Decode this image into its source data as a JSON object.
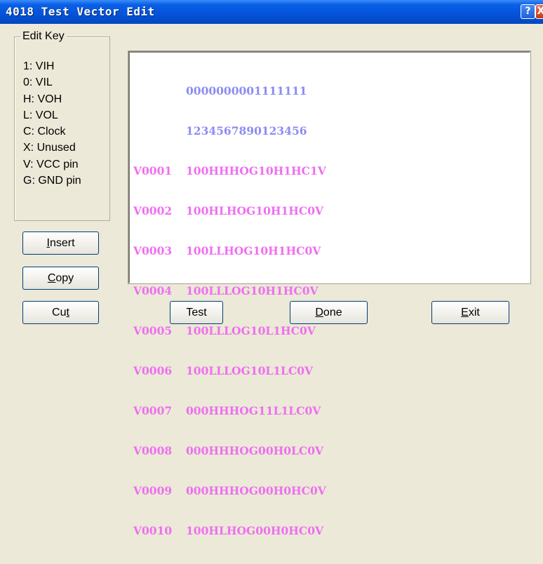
{
  "window": {
    "title": "4018 Test Vector Edit",
    "help_glyph": "?",
    "close_glyph": "X"
  },
  "edit_key": {
    "legend": "Edit Key",
    "items": [
      "1: VIH",
      "0: VIL",
      "H: VOH",
      "L: VOL",
      "C: Clock",
      "X: Unused",
      "V: VCC pin",
      "G: GND pin"
    ]
  },
  "editor": {
    "header_rows": [
      "0000000001111111",
      "1234567890123456"
    ],
    "vectors": [
      {
        "id": "V0001",
        "pattern": "100HHHOG10H1HC1V"
      },
      {
        "id": "V0002",
        "pattern": "100HLHOG10H1HC0V"
      },
      {
        "id": "V0003",
        "pattern": "100LLHOG10H1HC0V"
      },
      {
        "id": "V0004",
        "pattern": "100LLLOG10H1HC0V"
      },
      {
        "id": "V0005",
        "pattern": "100LLLOG10L1HC0V"
      },
      {
        "id": "V0006",
        "pattern": "100LLLOG10L1LC0V"
      },
      {
        "id": "V0007",
        "pattern": "000HHHOG11L1LC0V"
      },
      {
        "id": "V0008",
        "pattern": "000HHHOG00H0LC0V"
      },
      {
        "id": "V0009",
        "pattern": "000HHHOG00H0HC0V"
      },
      {
        "id": "V0010",
        "pattern": "100HLHOG00H0HC0V"
      }
    ]
  },
  "buttons": {
    "insert": {
      "pre": "",
      "acc": "I",
      "post": "nsert"
    },
    "copy": {
      "pre": "",
      "acc": "C",
      "post": "opy"
    },
    "cut": {
      "pre": "Cu",
      "acc": "t",
      "post": ""
    },
    "test": {
      "pre": "Test",
      "acc": "",
      "post": ""
    },
    "done": {
      "pre": "",
      "acc": "D",
      "post": "one"
    },
    "exit": {
      "pre": "",
      "acc": "E",
      "post": "xit"
    }
  },
  "colors": {
    "title_bar": "#0453d8",
    "header_text": "#8c8cf2",
    "vector_text": "#ef6ef0",
    "window_bg": "#ece9d8"
  }
}
